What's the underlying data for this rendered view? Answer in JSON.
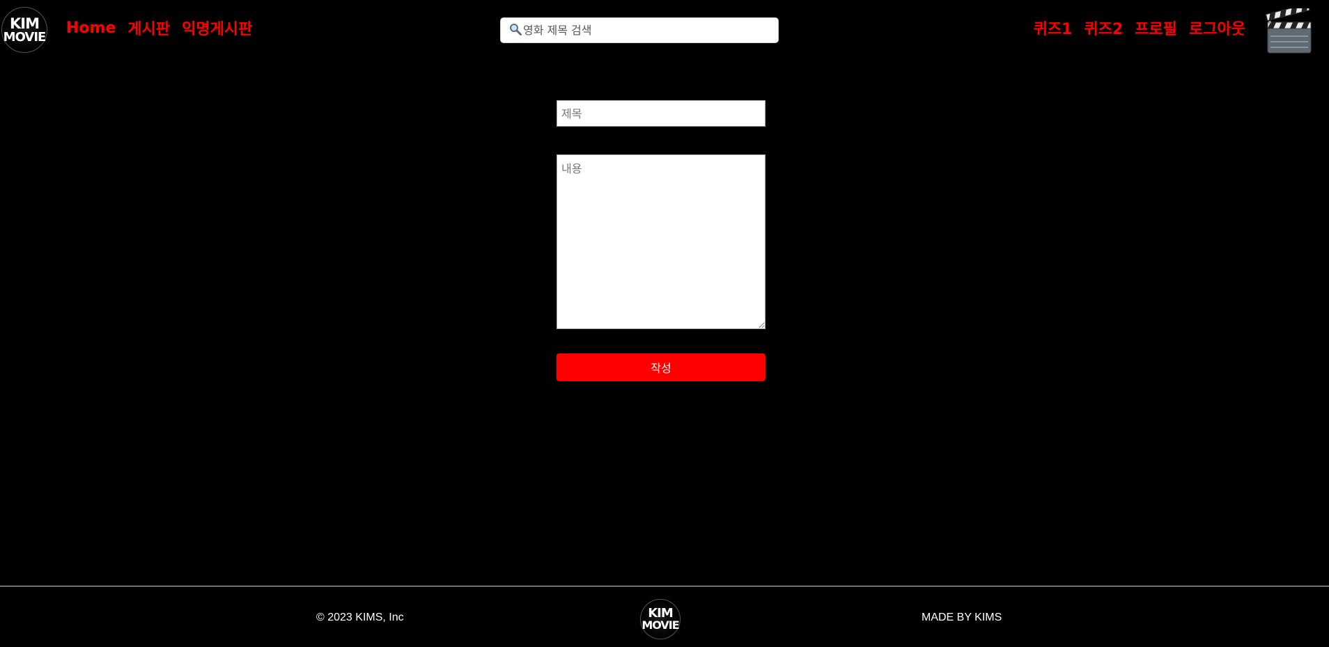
{
  "header": {
    "logo": {
      "line1": "KIM",
      "line2": "MOVIE"
    },
    "nav_left": [
      {
        "label": "Home"
      },
      {
        "label": "게시판"
      },
      {
        "label": "익명게시판"
      }
    ],
    "search": {
      "placeholder": "영화 제목 검색",
      "value": "",
      "icon": "magnifier-icon"
    },
    "nav_right": [
      {
        "label": "퀴즈1"
      },
      {
        "label": "퀴즈2"
      },
      {
        "label": "프로필"
      },
      {
        "label": "로그아웃"
      }
    ],
    "clapper_icon": "clapperboard-icon"
  },
  "form": {
    "title_placeholder": "제목",
    "title_value": "",
    "content_placeholder": "내용",
    "content_value": "",
    "submit_label": "작성"
  },
  "footer": {
    "copyright": "© 2023 KIMS, Inc",
    "logo": {
      "line1": "KIM",
      "line2": "MOVIE"
    },
    "made_by": "MADE BY KIMS"
  },
  "colors": {
    "background": "#000000",
    "accent": "#ff0000",
    "text_light": "#ffffff",
    "divider": "#cfcfcf"
  }
}
